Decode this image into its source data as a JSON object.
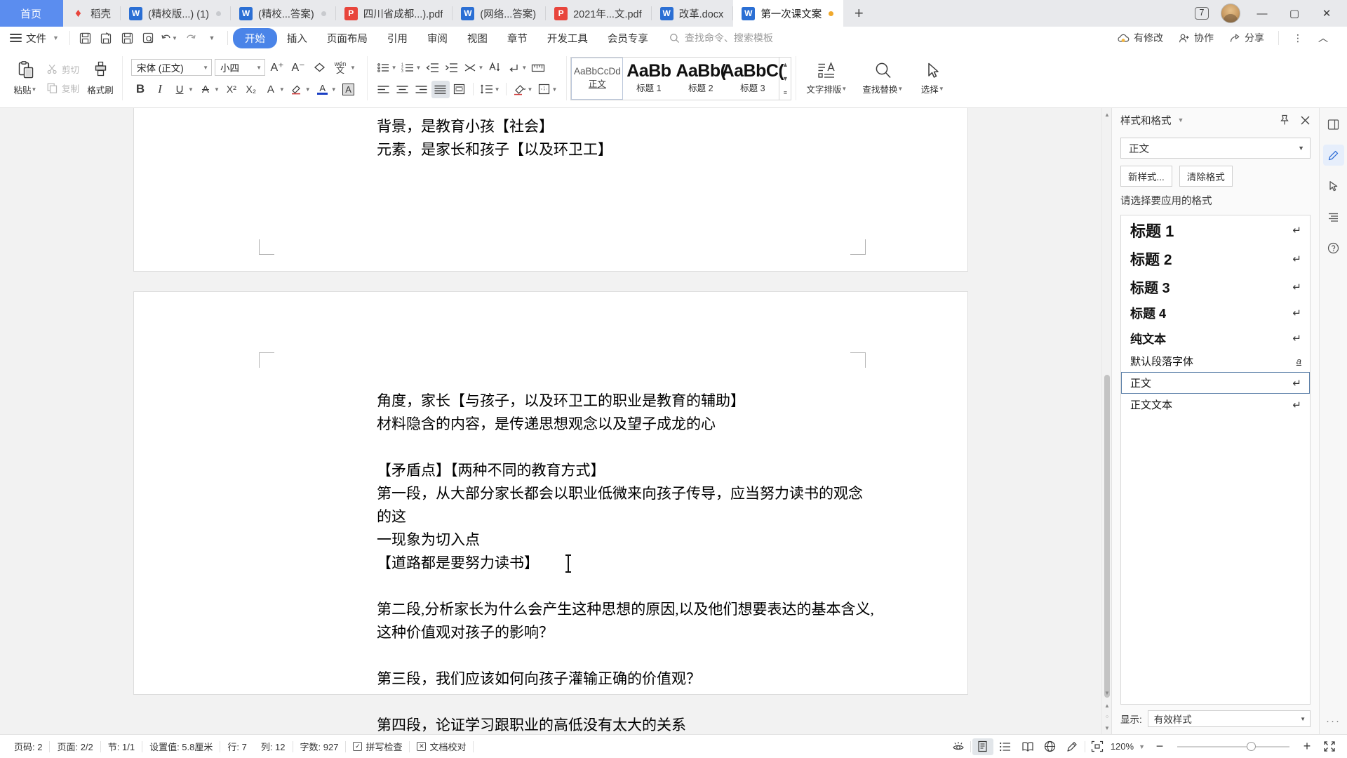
{
  "window": {
    "tabs": [
      {
        "label": "首页",
        "type": "home"
      },
      {
        "label": "稻壳",
        "type": "docer"
      },
      {
        "label": "(精校版...) (1)",
        "type": "doc"
      },
      {
        "label": "(精校...答案)",
        "type": "doc"
      },
      {
        "label": "四川省成都...).pdf",
        "type": "pdf"
      },
      {
        "label": "(网络...答案)",
        "type": "doc"
      },
      {
        "label": "2021年...文.pdf",
        "type": "pdf"
      },
      {
        "label": "改革.docx",
        "type": "doc"
      },
      {
        "label": "第一次课文案",
        "type": "doc",
        "active": true,
        "modified": true
      }
    ],
    "new_tab_label": "+",
    "tab_count_badge": "7",
    "minimize_label": "—",
    "maximize_label": "▢",
    "close_label": "✕"
  },
  "menu": {
    "file_label": "文件",
    "quick_access": [
      "save-icon",
      "save-as-icon",
      "print-icon",
      "print-preview-icon",
      "undo-icon",
      "redo-icon",
      "customize-icon"
    ],
    "items": [
      {
        "label": "开始",
        "selected": true
      },
      {
        "label": "插入"
      },
      {
        "label": "页面布局"
      },
      {
        "label": "引用"
      },
      {
        "label": "审阅"
      },
      {
        "label": "视图"
      },
      {
        "label": "章节"
      },
      {
        "label": "开发工具"
      },
      {
        "label": "会员专享"
      }
    ],
    "search_placeholder": "查找命令、搜索模板",
    "right_items": [
      {
        "label": "有修改",
        "icon": "cloud-sync-icon"
      },
      {
        "label": "协作",
        "icon": "collaborate-icon"
      },
      {
        "label": "分享",
        "icon": "share-icon"
      }
    ],
    "more_label": "⋮",
    "collapse_label": "︿"
  },
  "ribbon": {
    "clipboard": {
      "paste_label": "粘贴",
      "cut_label": "剪切",
      "copy_label": "复制",
      "format_painter_label": "格式刷"
    },
    "font": {
      "family_value": "宋体 (正文)",
      "size_value": "小四",
      "grow_label": "A⁺",
      "shrink_label": "A⁻",
      "clear_format_label": "clear-format-icon",
      "pinyin_label": "wén",
      "bold_label": "B",
      "italic_label": "I",
      "underline_label": "U",
      "strikethrough_label": "A",
      "superscript_label": "X²",
      "subscript_label": "X₂",
      "char_border_label": "A",
      "highlight_label": "highlight-icon",
      "font_color_label": "A",
      "char_shading_label": "A"
    },
    "paragraph": {
      "bullets_label": "bullet-list-icon",
      "numbering_label": "numbered-list-icon",
      "decrease_indent_label": "decrease-indent-icon",
      "increase_indent_label": "increase-indent-icon",
      "sort_label": "sort-icon",
      "sort_az_label": "sort-az-icon",
      "show_marks_label": "show-marks-icon",
      "ruler_label": "ruler-icon",
      "align_left_label": "align-left-icon",
      "align_center_label": "align-center-icon",
      "align_right_label": "align-right-icon",
      "align_justify_label": "align-justify-icon",
      "distribute_label": "distribute-icon",
      "line_spacing_label": "line-spacing-icon",
      "shading_label": "shading-icon",
      "borders_label": "borders-icon"
    },
    "styles": {
      "items": [
        {
          "preview": "AaBbCcDd",
          "name": "正文",
          "selected": true,
          "size": "small"
        },
        {
          "preview": "AaBb",
          "name": "标题 1",
          "size": "big"
        },
        {
          "preview": "AaBb(",
          "name": "标题 2",
          "size": "big"
        },
        {
          "preview": "AaBbC(",
          "name": "标题 3",
          "size": "big"
        }
      ]
    },
    "text_layout_label": "文字排版",
    "find_replace_label": "查找替换",
    "select_label": "选择"
  },
  "document": {
    "page1_lines": [
      "背景，是教育小孩【社会】",
      "元素，是家长和孩子【以及环卫工】"
    ],
    "page2_blocks": [
      [
        "角度，家长【与孩子，以及环卫工的职业是教育的辅助】",
        "材料隐含的内容，是传递思想观念以及望子成龙的心"
      ],
      [
        ""
      ],
      [
        "【矛盾点】【两种不同的教育方式】",
        "第一段，从大部分家长都会以职业低微来向孩子传导，应当努力读书的观念的这",
        "一现象为切入点",
        "【道路都是要努力读书】"
      ],
      [
        ""
      ],
      [
        "第二段,分析家长为什么会产生这种思想的原因,以及他们想要表达的基本含义,",
        "这种价值观对孩子的影响？"
      ],
      [
        ""
      ],
      [
        "第三段，我们应该如何向孩子灌输正确的价值观？"
      ],
      [
        ""
      ],
      [
        "第四段，论证学习跟职业的高低没有太大的关系"
      ]
    ]
  },
  "styles_panel": {
    "title": "样式和格式",
    "pin_icon": "pin-icon",
    "close_icon": "close-icon",
    "current_style": "正文",
    "new_style_label": "新样式...",
    "clear_format_label": "清除格式",
    "prompt_label": "请选择要应用的格式",
    "list": [
      {
        "label": "标题 1",
        "mark": "↵",
        "weight": "bold",
        "size": 22
      },
      {
        "label": "标题 2",
        "mark": "↵",
        "weight": "bold",
        "size": 21
      },
      {
        "label": "标题 3",
        "mark": "↵",
        "weight": "bold",
        "size": 20
      },
      {
        "label": "标题 4",
        "mark": "↵",
        "weight": "bold",
        "size": 18
      },
      {
        "label": "纯文本",
        "mark": "↵",
        "weight": "bold",
        "size": 17
      },
      {
        "label": "默认段落字体",
        "mark": "a",
        "weight": "normal",
        "size": 15
      },
      {
        "label": "正文",
        "mark": "↵",
        "weight": "normal",
        "size": 15,
        "selected": true
      },
      {
        "label": "正文文本",
        "mark": "↵",
        "weight": "normal",
        "size": 15
      }
    ],
    "show_label": "显示:",
    "show_value": "有效样式"
  },
  "rail": {
    "items": [
      {
        "icon": "panel-collapse-icon",
        "name": "panel-collapse"
      },
      {
        "icon": "pen-edit-icon",
        "name": "style-panel",
        "active": true
      },
      {
        "icon": "cursor-select-icon",
        "name": "selection-pane"
      },
      {
        "icon": "paragraph-marks-icon",
        "name": "paragraph-settings"
      },
      {
        "icon": "help-icon",
        "name": "help"
      }
    ],
    "more_label": "···"
  },
  "status": {
    "page_label": "页码: 2",
    "pages_label": "页面: 2/2",
    "section_label": "节: 1/1",
    "setting_label": "设置值: 5.8厘米",
    "row_label": "行: 7",
    "col_label": "列: 12",
    "words_label": "字数: 927",
    "spellcheck_label": "拼写检查",
    "proofread_label": "文档校对",
    "view_icons": [
      "eye-protection-icon",
      "page-view-icon",
      "outline-view-icon",
      "reading-view-icon",
      "web-view-icon",
      "edit-view-icon"
    ],
    "fit_icon": "fit-page-icon",
    "zoom_value": "120%",
    "zoom_out_label": "−",
    "zoom_in_label": "+",
    "fullscreen_icon": "fullscreen-icon"
  },
  "colors": {
    "accent": "#4a84e8",
    "home_tab": "#5b8def",
    "word_icon": "#2b6fd4",
    "pdf_icon": "#e8453c",
    "modified_dot": "#f0a92c"
  }
}
